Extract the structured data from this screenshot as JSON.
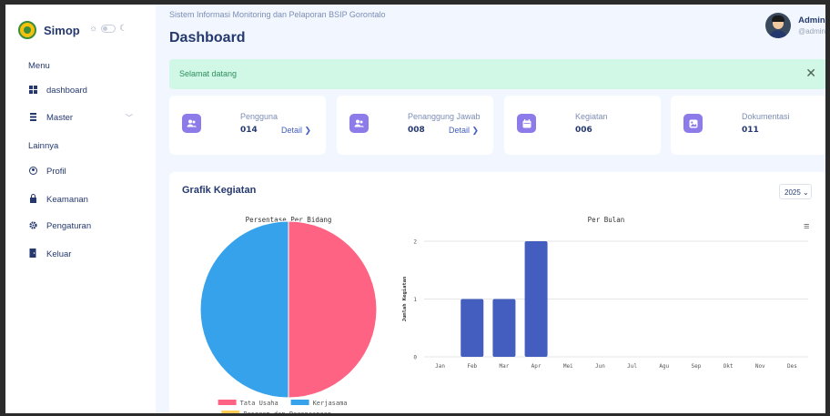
{
  "sidebar": {
    "brand": "Simop",
    "theme": {
      "light_icon": "sun-icon",
      "dark_icon": "moon-icon"
    },
    "section_menu": "Menu",
    "items_menu": [
      {
        "label": "dashboard",
        "icon": "grid-icon"
      },
      {
        "label": "Master",
        "icon": "stack-icon",
        "has_submenu": true
      }
    ],
    "section_lainnya": "Lainnya",
    "items_lainnya": [
      {
        "label": "Profil",
        "icon": "user-circle-icon"
      },
      {
        "label": "Keamanan",
        "icon": "lock-icon"
      },
      {
        "label": "Pengaturan",
        "icon": "gear-icon"
      },
      {
        "label": "Keluar",
        "icon": "door-icon"
      }
    ]
  },
  "header": {
    "subtitle": "Sistem Informasi Monitoring dan Pelaporan BSIP Gorontalo",
    "title": "Dashboard"
  },
  "user": {
    "name": "Admin",
    "handle": "@admin"
  },
  "alert": {
    "text": "Selamat datang",
    "close_symbol": "✕"
  },
  "stats": [
    {
      "label": "Pengguna",
      "value": "014",
      "link": "Detail ❯"
    },
    {
      "label": "Penanggung Jawab",
      "value": "008",
      "link": "Detail ❯"
    },
    {
      "label": "Kegiatan",
      "value": "006"
    },
    {
      "label": "Dokumentasi",
      "value": "011"
    }
  ],
  "chart_section": {
    "title": "Grafik Kegiatan",
    "year": "2025"
  },
  "colors": {
    "accent": "#435ebe",
    "icon_bg": "#8c7be8",
    "alert_bg": "#d1f8e6",
    "pie_red": "#ff6384",
    "pie_blue": "#36a2eb",
    "bar": "#435ebe",
    "legend_yellow": "#ffcd56"
  },
  "chart_data": [
    {
      "type": "pie",
      "title": "Persentase Per Bidang",
      "labels": [
        "Tata Usaha",
        "Kerjasama",
        "Program dan Perencanaan"
      ],
      "values": [
        50,
        50,
        0
      ],
      "legend": "bottom"
    },
    {
      "type": "bar",
      "title": "Per Bulan",
      "categories": [
        "Jan",
        "Feb",
        "Mar",
        "Apr",
        "Mei",
        "Jun",
        "Jul",
        "Agu",
        "Sep",
        "Okt",
        "Nov",
        "Des"
      ],
      "values": [
        0,
        1,
        1,
        2,
        0,
        0,
        0,
        0,
        0,
        0,
        0,
        0
      ],
      "ylabel": "Jumlah Kegiatan",
      "yticks": [
        "0",
        "1",
        "2"
      ],
      "ylim": [
        0,
        2
      ],
      "grid": true
    }
  ]
}
